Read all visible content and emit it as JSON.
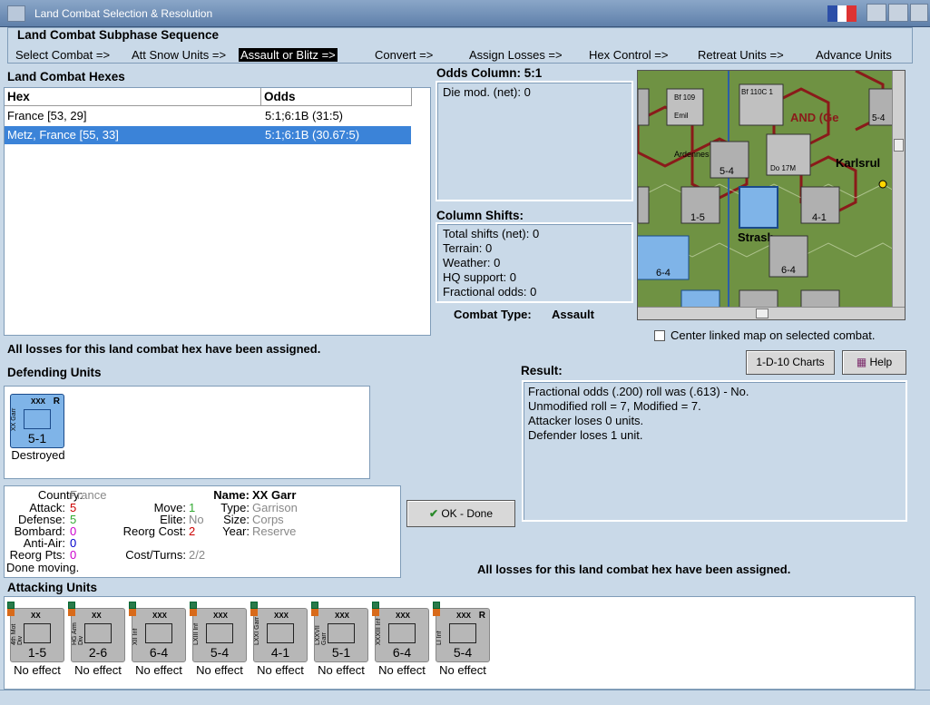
{
  "window": {
    "title": "Land Combat Selection & Resolution"
  },
  "sequence": {
    "title": "Land Combat Subphase Sequence",
    "steps": [
      "Select Combat =>",
      "Att Snow Units =>",
      "Assault or Blitz =>",
      "Convert =>",
      "Assign Losses =>",
      "Hex Control =>",
      "Retreat Units =>",
      "Advance Units"
    ],
    "active_index": 2
  },
  "hexes": {
    "title": "Land Combat Hexes",
    "col_hex": "Hex",
    "col_odds": "Odds",
    "rows": [
      {
        "hex": "France [53, 29]",
        "odds": "5:1;6:1B (31:5)"
      },
      {
        "hex": "Metz, France [55, 33]",
        "odds": "5:1;6:1B (30.67:5)",
        "selected": true
      }
    ]
  },
  "odds": {
    "title": "Odds Column: 5:1",
    "die_mod": "Die mod. (net): 0"
  },
  "shifts": {
    "title": "Column Shifts:",
    "lines": [
      "Total shifts (net): 0",
      "Terrain: 0",
      "Weather: 0",
      "HQ support: 0",
      "Fractional odds: 0"
    ]
  },
  "combat_type": {
    "label": "Combat Type:",
    "value": "Assault"
  },
  "center_map": {
    "label": "Center linked map on selected combat.",
    "checked": false
  },
  "losses_msg": "All losses for this land combat hex have been assigned.",
  "losses_msg2": "All losses for this land combat hex have been assigned.",
  "buttons": {
    "charts": "1-D-10 Charts",
    "help": "Help",
    "ok": "OK - Done"
  },
  "result": {
    "title": "Result:",
    "lines": [
      "Fractional odds (.200) roll was (.613)  - No.",
      "Unmodified roll = 7, Modified = 7.",
      "Attacker loses 0 units.",
      "Defender loses 1 unit."
    ]
  },
  "defending": {
    "title": "Defending Units",
    "units": [
      {
        "name": "XX Garr",
        "size": "XXX",
        "value": "5-1",
        "reserve": "R",
        "status": "Destroyed"
      }
    ]
  },
  "details": {
    "country_k": "Country:",
    "country_v": "France",
    "attack_k": "Attack:",
    "attack_v": "5",
    "defense_k": "Defense:",
    "defense_v": "5",
    "bombard_k": "Bombard:",
    "bombard_v": "0",
    "antiair_k": "Anti-Air:",
    "antiair_v": "0",
    "reorg_pts_k": "Reorg Pts:",
    "reorg_pts_v": "0",
    "done": "Done moving.",
    "move_k": "Move:",
    "move_v": "1",
    "elite_k": "Elite:",
    "elite_v": "No",
    "reorg_cost_k": "Reorg Cost:",
    "reorg_cost_v": "2",
    "cost_turns_k": "Cost/Turns:",
    "cost_turns_v": "2/2",
    "name_k": "Name:",
    "name_v": "XX Garr",
    "type_k": "Type:",
    "type_v": "Garrison",
    "size_k": "Size:",
    "size_v": "Corps",
    "year_k": "Year:",
    "year_v": "Reserve"
  },
  "attacking": {
    "title": "Attacking Units",
    "units": [
      {
        "name": "4th Mot Div",
        "size": "XX",
        "value": "1-5",
        "status": "No effect"
      },
      {
        "name": "HG Arm Div",
        "size": "XX",
        "value": "2-6",
        "status": "No effect"
      },
      {
        "name": "XII Inf",
        "size": "XXX",
        "value": "6-4",
        "status": "No effect"
      },
      {
        "name": "LXIII Inf",
        "size": "XXX",
        "value": "5-4",
        "status": "No effect"
      },
      {
        "name": "LXXI Garr",
        "size": "XXX",
        "value": "4-1",
        "status": "No effect"
      },
      {
        "name": "LXXVII Garr",
        "size": "XXX",
        "value": "5-1",
        "status": "No effect"
      },
      {
        "name": "XXXIII Inf",
        "size": "XXX",
        "value": "6-4",
        "status": "No effect"
      },
      {
        "name": "LI Inf",
        "size": "XXX",
        "value": "5-4",
        "reserve": "R",
        "status": "No effect"
      }
    ]
  },
  "map": {
    "labels": [
      "Bf 109",
      "Bf 110C 1",
      "AND (Ge",
      "Karlsrul",
      "Ardennes",
      "Strasb",
      "Do 17M",
      "Emil",
      "1-5",
      "5-4",
      "4-1",
      "6-4",
      "6-4",
      "5-4"
    ]
  }
}
